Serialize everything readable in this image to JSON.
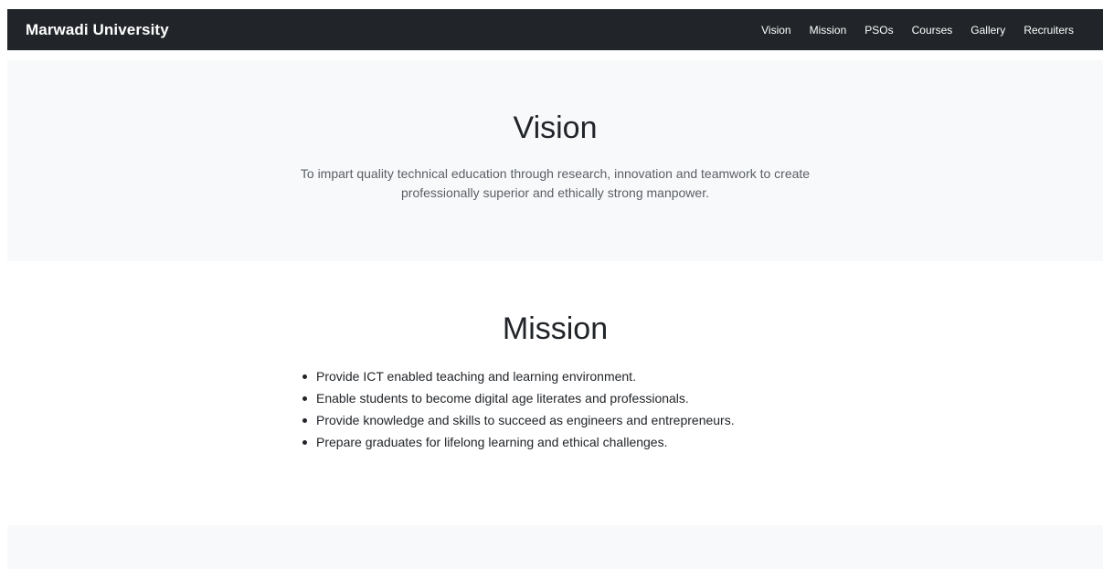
{
  "navbar": {
    "brand": "Marwadi University",
    "links": [
      "Vision",
      "Mission",
      "PSOs",
      "Courses",
      "Gallery",
      "Recruiters"
    ]
  },
  "vision": {
    "title": "Vision",
    "text": "To impart quality technical education through research, innovation and teamwork to create professionally superior and ethically strong manpower."
  },
  "mission": {
    "title": "Mission",
    "items": [
      "Provide ICT enabled teaching and learning environment.",
      "Enable students to become digital age literates and professionals.",
      "Provide knowledge and skills to succeed as engineers and entrepreneurs.",
      "Prepare graduates for lifelong learning and ethical challenges."
    ]
  },
  "colors": {
    "navbar_background": "#212529",
    "section_light": "#f8f9fa",
    "text_primary": "#212529",
    "text_muted": "#5a5f66"
  }
}
